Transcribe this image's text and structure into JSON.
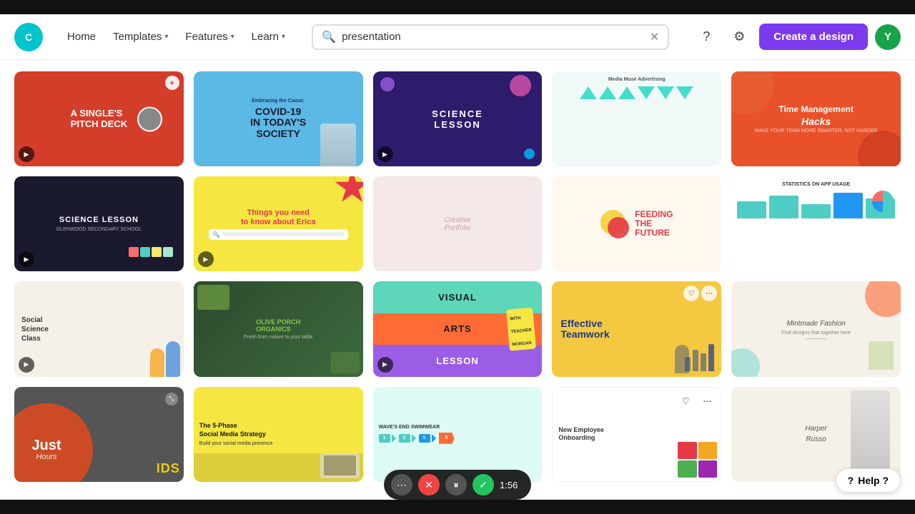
{
  "topBar": {},
  "header": {
    "logo": "C",
    "nav": {
      "home": "Home",
      "templates": "Templates",
      "features": "Features",
      "learn": "Learn"
    },
    "search": {
      "placeholder": "presentation",
      "value": "presentation"
    },
    "createBtn": "Create a design",
    "avatarLetter": "Y"
  },
  "grid": {
    "rows": [
      [
        {
          "id": "c1",
          "bg": "#D43D2A",
          "text": "A SINGLE'S\nPITCH DECK",
          "textColor": "white",
          "hasPlay": true,
          "hasPlus": true
        },
        {
          "id": "c2",
          "bg": "#5CB8E4",
          "text": "COVID-19\nIN TODAY'S\nSOCIETY",
          "textColor": "#1a1a2e",
          "hasPlay": false
        },
        {
          "id": "c3",
          "bg": "#2D1B6B",
          "text": "SCIENCE LESSON",
          "textColor": "white",
          "hasPlay": true
        },
        {
          "id": "c4",
          "bg": "#F0F8F8",
          "text": "Media Muse Advertising",
          "textColor": "#333",
          "hasPlay": false
        },
        {
          "id": "c5",
          "bg": "#E8512A",
          "text": "Time Management\nHacks",
          "textColor": "white",
          "hasPlay": false
        }
      ],
      [
        {
          "id": "c6",
          "bg": "#1a1a2e",
          "text": "SCIENCE LESSON",
          "textColor": "white",
          "hasPlay": true
        },
        {
          "id": "c7",
          "bg": "#F5E642",
          "text": "Things you need\nto know about Erica",
          "textColor": "#e63946",
          "hasPlay": true
        },
        {
          "id": "c8",
          "bg": "#F5E8E8",
          "text": "Creative Portfolio",
          "textColor": "#c9a0a0",
          "hasPlay": false
        },
        {
          "id": "c9",
          "bg": "#FFF8EE",
          "text": "FEEDING\nTHE\nFUTURE",
          "textColor": "#e63946",
          "hasPlay": false
        },
        {
          "id": "c10",
          "bg": "#fff",
          "text": "STATISTICS ON APP USAGE",
          "textColor": "#333",
          "hasPlay": false
        }
      ],
      [
        {
          "id": "c11",
          "bg": "#F5F0E8",
          "text": "Social Science Class",
          "textColor": "#333",
          "hasPlay": true
        },
        {
          "id": "c12",
          "bg": "#2D4A2D",
          "text": "OLIVE PORCH ORGANICS",
          "textColor": "#8BC34A",
          "hasPlay": false
        },
        {
          "id": "c13",
          "bg": "#5DD6BA",
          "text": "VISUAL\nARTS\nLESSON",
          "textColor": "#1a1a1a",
          "hasPlay": true
        },
        {
          "id": "c14",
          "bg": "#F5C842",
          "text": "Effective\nTeamwork",
          "textColor": "#1a3a8a",
          "hasPlay": false
        },
        {
          "id": "c15",
          "bg": "#F5F0E8",
          "text": "Mintmade Fashion",
          "textColor": "#555",
          "hasPlay": false
        }
      ],
      [
        {
          "id": "c16",
          "bg": "#CC4B24",
          "text": "Just\nHours",
          "textColor": "white",
          "isCircle": true,
          "hasPlay": false
        },
        {
          "id": "c17",
          "bg": "#F5E642",
          "text": "The 5-Phase\nSocial Media Strategy",
          "textColor": "#1a1a1a",
          "hasPlay": false
        },
        {
          "id": "c18",
          "bg": "#DDFAF4",
          "text": "WAVE'S END SWIMWEAR",
          "textColor": "#333",
          "hasPlay": false
        },
        {
          "id": "c19",
          "bg": "#fff",
          "text": "New Employee\nOnboarding",
          "textColor": "#333",
          "hasPlay": false,
          "hasActions": true
        },
        {
          "id": "c20",
          "bg": "#F5F0E8",
          "text": "Harper Russo",
          "textColor": "#555",
          "hasPlay": false
        }
      ]
    ]
  },
  "recordingBar": {
    "more": "⋯",
    "cancel": "✕",
    "pause": "⏸",
    "confirm": "✓",
    "time": "1:56"
  },
  "justIds": {
    "big": "Just",
    "sub": "Hours",
    "extraText": "IDS"
  },
  "helpBtn": "Help ?"
}
